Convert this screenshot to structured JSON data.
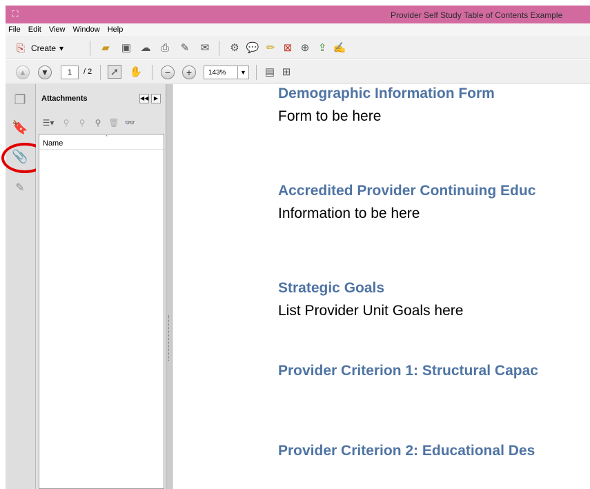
{
  "window": {
    "title": "Provider Self Study Table of Contents Example"
  },
  "menu": [
    "File",
    "Edit",
    "View",
    "Window",
    "Help"
  ],
  "toolbar": {
    "create_label": "Create",
    "create_caret": "▾"
  },
  "nav": {
    "page_current": "1",
    "page_total": "/ 2",
    "zoom": "143%"
  },
  "attachments_panel": {
    "title": "Attachments",
    "column_name": "Name",
    "sort_indicator": "ˆ"
  },
  "document": {
    "sections": [
      {
        "heading": "Demographic Information Form",
        "body": "Form to be here"
      },
      {
        "heading": "Accredited Provider Continuing Educ",
        "body": "Information to be here"
      },
      {
        "heading": "Strategic Goals",
        "body": "List Provider Unit Goals here"
      },
      {
        "heading": "Provider Criterion 1: Structural Capac",
        "body": ""
      },
      {
        "heading": "Provider Criterion 2: Educational Des",
        "body": ""
      }
    ]
  },
  "colors": {
    "titlebar": "#d26aa0",
    "heading": "#4f74a4",
    "highlight_circle": "#e10000"
  }
}
